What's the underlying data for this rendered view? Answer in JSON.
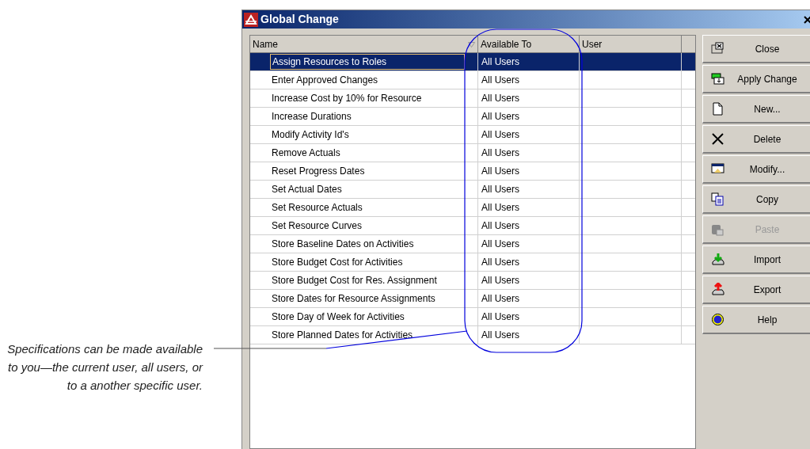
{
  "annotation": "Specifications can be made available to you—the current user, all users, or to a another specific user.",
  "window": {
    "title": "Global Change"
  },
  "table": {
    "columns": [
      "Name",
      "Available To",
      "User"
    ],
    "rows": [
      {
        "name": "Assign Resources to Roles",
        "available_to": "All Users",
        "selected": true
      },
      {
        "name": "Enter Approved Changes",
        "available_to": "All Users",
        "selected": false
      },
      {
        "name": "Increase Cost by 10% for Resource",
        "available_to": "All Users",
        "selected": false
      },
      {
        "name": "Increase Durations",
        "available_to": "All Users",
        "selected": false
      },
      {
        "name": "Modify Activity Id's",
        "available_to": "All Users",
        "selected": false
      },
      {
        "name": "Remove Actuals",
        "available_to": "All Users",
        "selected": false
      },
      {
        "name": "Reset Progress Dates",
        "available_to": "All Users",
        "selected": false
      },
      {
        "name": "Set Actual Dates",
        "available_to": "All Users",
        "selected": false
      },
      {
        "name": "Set Resource Actuals",
        "available_to": "All Users",
        "selected": false
      },
      {
        "name": "Set Resource Curves",
        "available_to": "All Users",
        "selected": false
      },
      {
        "name": "Store Baseline Dates on Activities",
        "available_to": "All Users",
        "selected": false
      },
      {
        "name": "Store Budget Cost for Activities",
        "available_to": "All Users",
        "selected": false
      },
      {
        "name": "Store Budget Cost for Res. Assignment",
        "available_to": "All Users",
        "selected": false
      },
      {
        "name": "Store Dates for Resource Assignments",
        "available_to": "All Users",
        "selected": false
      },
      {
        "name": "Store Day of Week for Activities",
        "available_to": "All Users",
        "selected": false
      },
      {
        "name": "Store Planned Dates for Activities",
        "available_to": "All Users",
        "selected": false
      }
    ]
  },
  "buttons": [
    {
      "kind": "close",
      "label": "Close",
      "disabled": false
    },
    {
      "kind": "apply",
      "label": "Apply Change",
      "disabled": false
    },
    {
      "kind": "new",
      "label": "New...",
      "disabled": false
    },
    {
      "kind": "delete",
      "label": "Delete",
      "disabled": false
    },
    {
      "kind": "modify",
      "label": "Modify...",
      "disabled": false
    },
    {
      "kind": "copy",
      "label": "Copy",
      "disabled": false
    },
    {
      "kind": "paste",
      "label": "Paste",
      "disabled": true
    },
    {
      "kind": "import",
      "label": "Import",
      "disabled": false
    },
    {
      "kind": "export",
      "label": "Export",
      "disabled": false
    },
    {
      "kind": "help",
      "label": "Help",
      "disabled": false
    }
  ]
}
